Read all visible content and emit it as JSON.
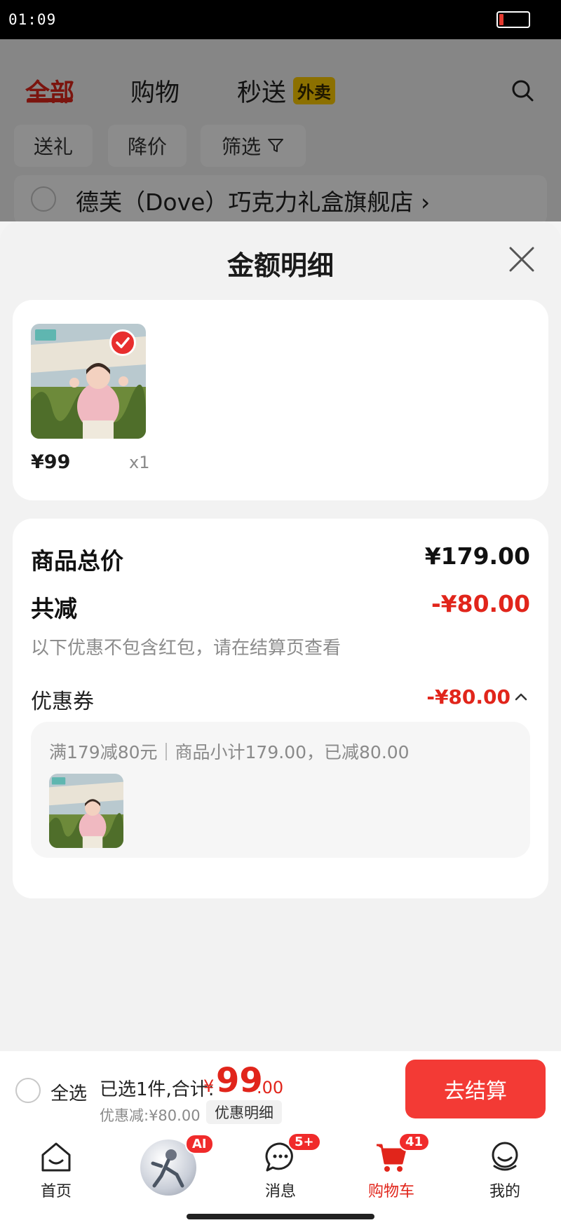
{
  "status_bar": {
    "time": "01:09",
    "battery_level_percent": 15
  },
  "top_tabs": [
    {
      "label": "全部",
      "active": true
    },
    {
      "label": "购物",
      "active": false
    },
    {
      "label": "秒送",
      "active": false,
      "badge": "外卖"
    }
  ],
  "filter_chips": [
    "送礼",
    "降价",
    "筛选"
  ],
  "store_name": "德芙（Dove）巧克力礼盒旗舰店",
  "sheet": {
    "title": "金额明细",
    "product": {
      "price": "¥99",
      "quantity": "x1"
    },
    "summary": {
      "total_label": "商品总价",
      "total_value": "¥179.00",
      "reduction_label": "共减",
      "reduction_value": "-¥80.00",
      "note": "以下优惠不包含红包，请在结算页查看",
      "coupon_label": "优惠券",
      "coupon_value": "-¥80.00",
      "coupon_detail": "满179减80元｜商品小计179.00，已减80.00"
    }
  },
  "bottom_bar": {
    "select_all": "全选",
    "selected_text": "已选1件,合计:",
    "currency": "¥",
    "total_integer": "99",
    "total_decimal": ".00",
    "discount_text": "优惠减:¥80.00",
    "detail_button": "优惠明细",
    "checkout_button": "去结算"
  },
  "nav": {
    "home": "首页",
    "ai_badge": "AI",
    "messages": "消息",
    "messages_badge": "5+",
    "cart": "购物车",
    "cart_badge": "41",
    "mine": "我的"
  },
  "colors": {
    "accent": "#e1251b",
    "checkout": "#f33a35",
    "badge": "#f02b2b",
    "waimai": "#ffcc00"
  }
}
